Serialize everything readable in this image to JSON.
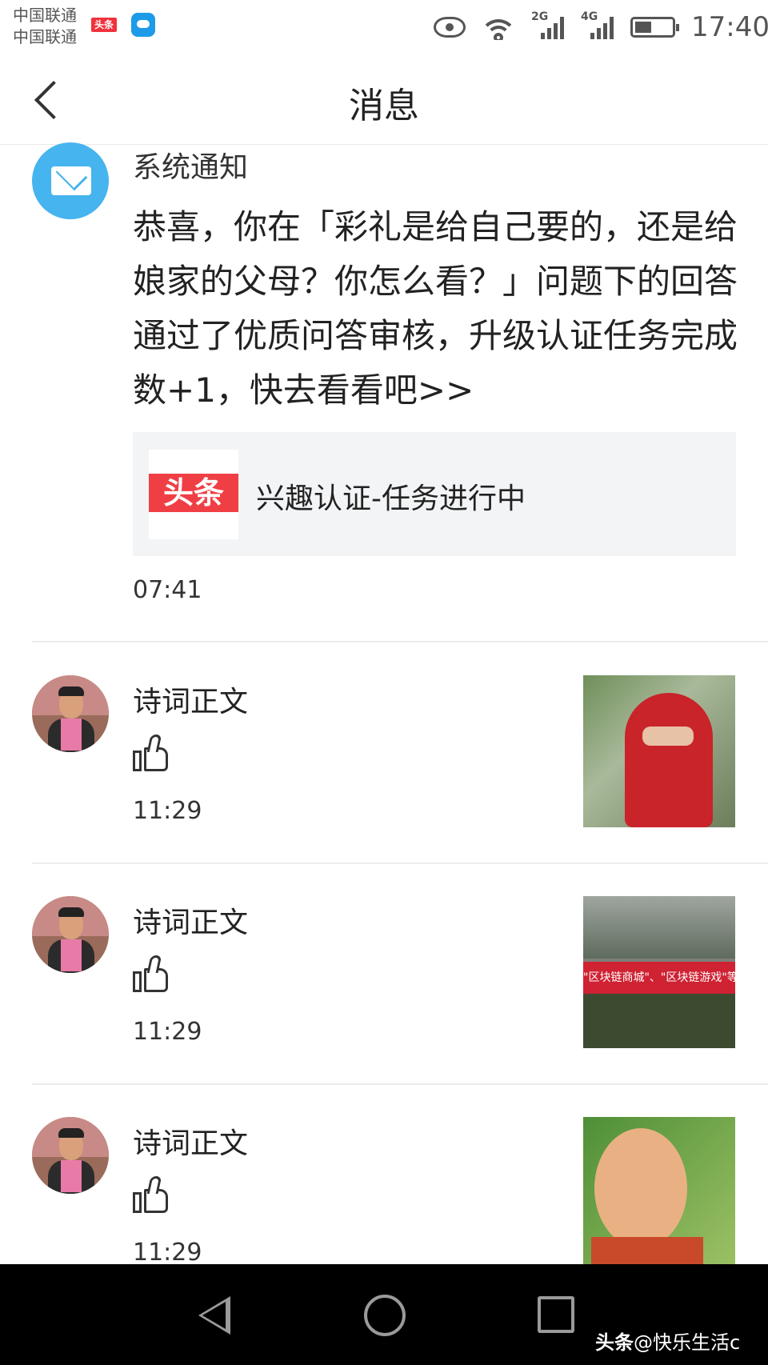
{
  "status_bar": {
    "carrier_1": "中国联通",
    "carrier_2": "中国联通",
    "app_badge": "头条",
    "signal_1": "2G",
    "signal_2": "4G",
    "time": "17:40"
  },
  "header": {
    "title": "消息"
  },
  "system_notice": {
    "name": "系统通知",
    "body": "恭喜，你在「彩礼是给自己要的，还是给娘家的父母？你怎么看？」问题下的回答通过了优质问答审核，升级认证任务完成数+1，快去看看吧>>",
    "card_logo": "头条",
    "card_text": "兴趣认证-任务进行中",
    "time": "07:41"
  },
  "messages": [
    {
      "name": "诗词正文",
      "time": "11:29"
    },
    {
      "name": "诗词正文",
      "time": "11:29"
    },
    {
      "name": "诗词正文",
      "time": "11:29",
      "image_banner": ""
    }
  ],
  "thumb_pics": {
    "pic2_banner": "\"区块链商城\"、\"区块链游戏\"等从事虚拟"
  },
  "watermark": {
    "brand": "头条",
    "handle": "@快乐生活c"
  },
  "colors": {
    "accent_blue": "#46b4ee",
    "toutiao_red": "#ef3f45",
    "card_bg": "#f3f4f5"
  },
  "icons": [
    "back-arrow-icon",
    "mail-icon",
    "thumbs-up-icon",
    "nav-back-icon",
    "nav-home-icon",
    "nav-recent-icon"
  ]
}
